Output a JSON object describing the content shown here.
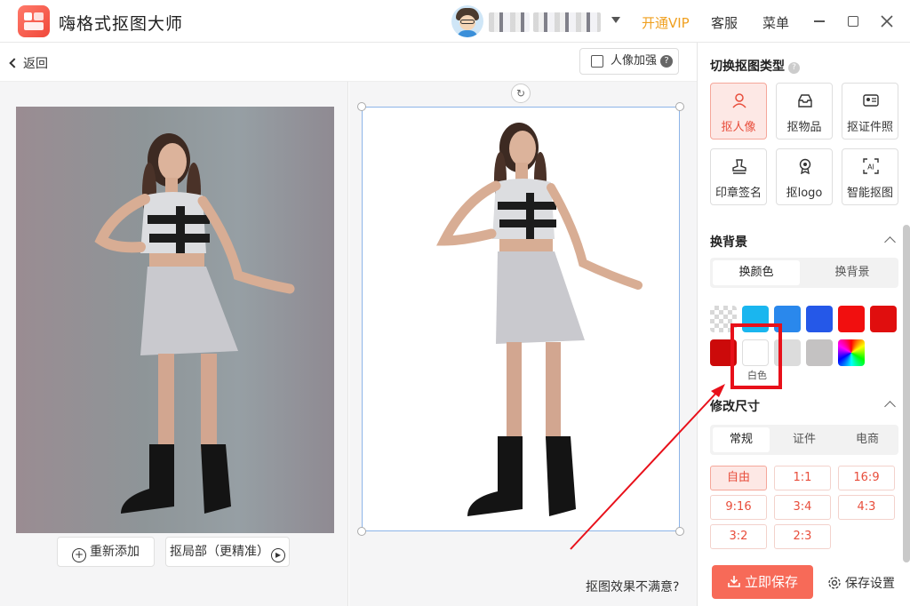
{
  "app": {
    "title": "嗨格式抠图大师",
    "vip_label": "开通VIP",
    "service_label": "客服",
    "menu_label": "菜单"
  },
  "subbar": {
    "back_label": "返回",
    "enhance_label": "人像加强",
    "enhance_help": "?"
  },
  "left": {
    "readd_label": "重新添加",
    "partial_label": "抠局部（更精准）"
  },
  "center": {
    "unsatisfied_label": "抠图效果不满意?"
  },
  "right": {
    "type_title": "切换抠图类型",
    "types": [
      {
        "label": "抠人像",
        "icon": "person-icon",
        "active": true
      },
      {
        "label": "抠物品",
        "icon": "inbox-icon",
        "active": false
      },
      {
        "label": "抠证件照",
        "icon": "id-card-icon",
        "active": false
      },
      {
        "label": "印章签名",
        "icon": "stamp-icon",
        "active": false
      },
      {
        "label": "抠logo",
        "icon": "badge-icon",
        "active": false
      },
      {
        "label": "智能抠图",
        "icon": "ai-icon",
        "active": false
      }
    ],
    "bg_title": "换背景",
    "bg_tabs": [
      "换颜色",
      "换背景"
    ],
    "colors_row1": [
      "transparent",
      "#1ab6ef",
      "#2a88ec",
      "#2558e8",
      "#f10f0f",
      "#e00e0e"
    ],
    "colors_row2": [
      "#cc0a0a",
      "#ffffff",
      "#dcdcdc",
      "#c4c2c2",
      "rainbow"
    ],
    "white_tooltip": "白色",
    "size_title": "修改尺寸",
    "size_tabs": [
      "常规",
      "证件",
      "电商"
    ],
    "ratios": [
      "自由",
      "1:1",
      "16:9",
      "9:16",
      "3:4",
      "4:3",
      "3:2",
      "2:3"
    ],
    "save_label": "立即保存",
    "save_settings_label": "保存设置"
  },
  "colors": {
    "accent": "#f76a58",
    "vip": "#f0a020",
    "annotation": "#e8101a"
  }
}
